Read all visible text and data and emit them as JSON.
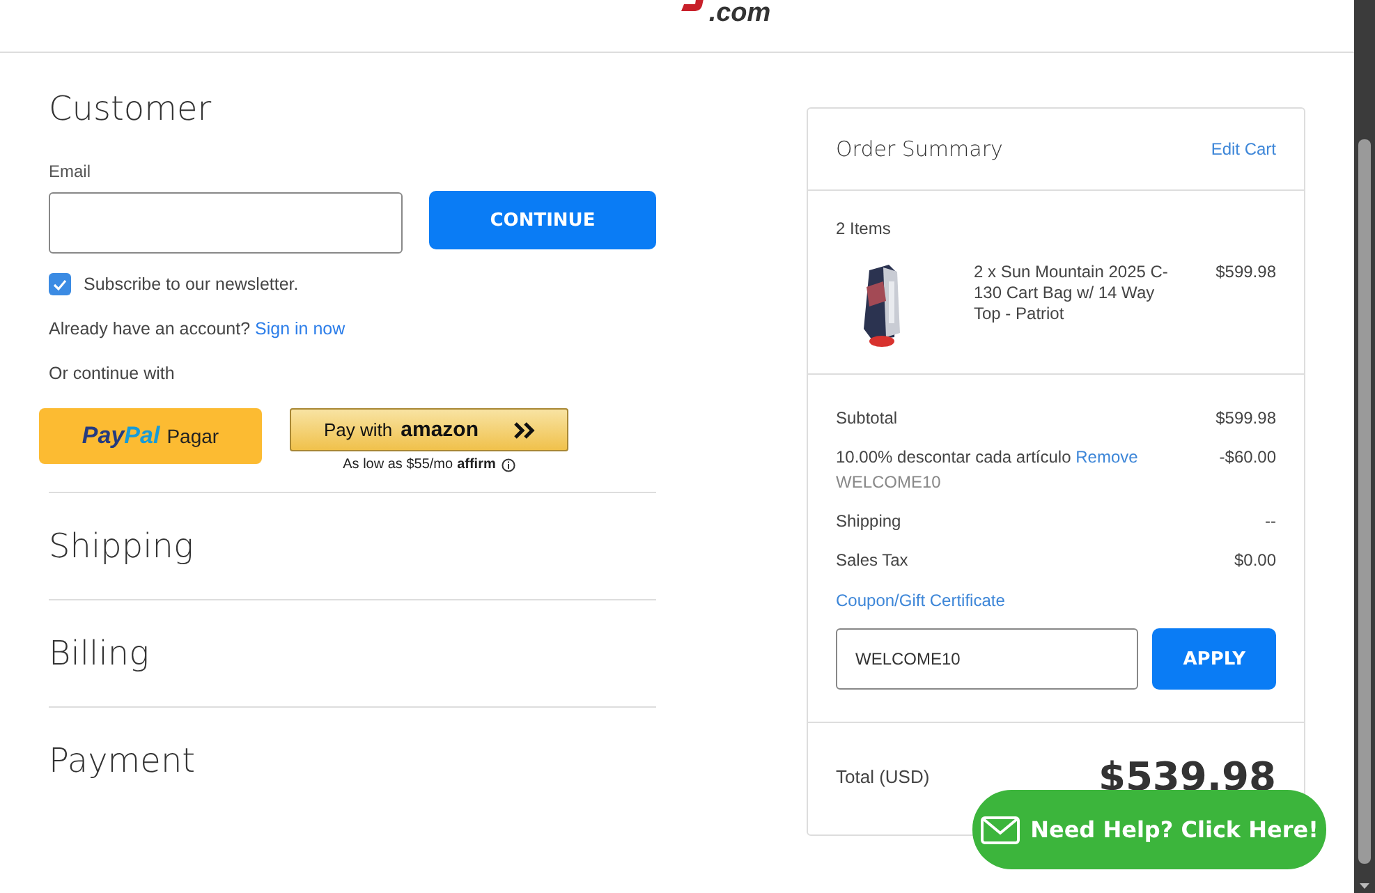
{
  "logo": {
    "text": ".com"
  },
  "customer": {
    "title": "Customer",
    "email_label": "Email",
    "continue_button": "CONTINUE",
    "newsletter": {
      "label": "Subscribe to our newsletter.",
      "checked": true
    },
    "account": {
      "text": "Already have an account?",
      "link": "Sign in now"
    },
    "alt_label": "Or continue with",
    "paypal": {
      "brand": "PayPal",
      "label": "Pagar"
    },
    "amazon": {
      "label": "Pay with",
      "brand": "amazon"
    },
    "affirm": {
      "text": "As low as $55/mo",
      "brand": "affirm"
    }
  },
  "sections": [
    "Shipping",
    "Billing",
    "Payment"
  ],
  "summary": {
    "title": "Order Summary",
    "edit_link": "Edit Cart",
    "item_count": "2 Items",
    "items": [
      {
        "name": "2 x Sun Mountain 2025 C-130 Cart Bag w/ 14 Way Top - Patriot",
        "price": "$599.98",
        "kind": "picture"
      }
    ],
    "lines": [
      {
        "label": "Subtotal",
        "value": "$599.98"
      },
      {
        "label": "10.00% descontar cada artículo",
        "link": "Remove",
        "code": "WELCOME10",
        "value": "-$60.00"
      },
      {
        "label": "Shipping",
        "value": "--"
      },
      {
        "label": "Sales Tax",
        "value": "$0.00"
      }
    ],
    "coupon": {
      "label": "Coupon/Gift Certificate",
      "value": "WELCOME10",
      "button": "APPLY"
    },
    "total": {
      "label": "Total (USD)",
      "value": "$539.98"
    }
  },
  "help": {
    "label": "Need Help? Click Here!"
  }
}
